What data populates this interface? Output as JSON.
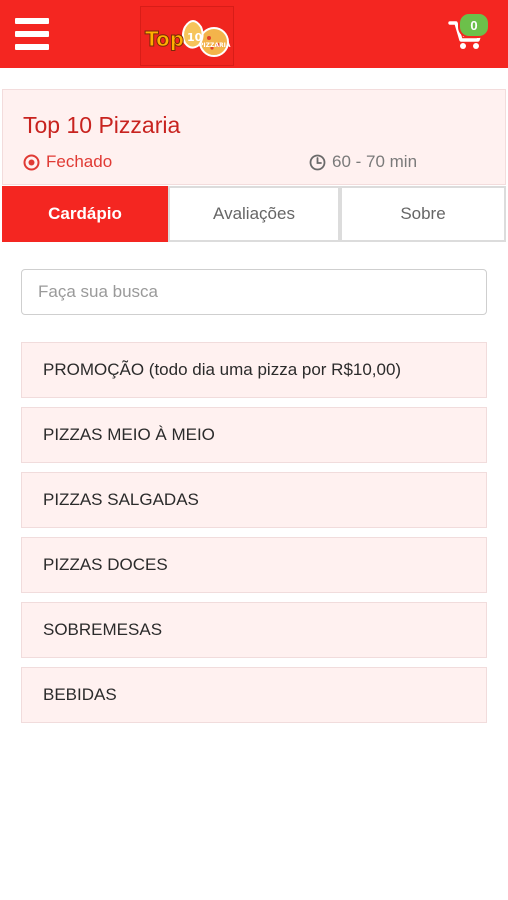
{
  "header": {
    "menu_icon": "hamburger-menu-icon",
    "logo": {
      "word": "Top",
      "digits": "10",
      "sub": "PIZZARIA"
    },
    "cart_icon": "shopping-cart-icon",
    "cart_count": "0",
    "colors": {
      "bar": "#f42621",
      "badge": "#6cc04a"
    }
  },
  "restaurant": {
    "name": "Top 10 Pizzaria",
    "status_icon": "closed-status-icon",
    "status": "Fechado",
    "time_icon": "clock-icon",
    "delivery_time": "60 - 70 min"
  },
  "tabs": [
    {
      "label": "Cardápio",
      "active": true
    },
    {
      "label": "Avaliações",
      "active": false
    },
    {
      "label": "Sobre",
      "active": false
    }
  ],
  "search": {
    "placeholder": "Faça sua busca",
    "value": ""
  },
  "categories": [
    "PROMOÇÃO (todo dia uma pizza por R$10,00)",
    "PIZZAS MEIO À MEIO",
    "PIZZAS SALGADAS",
    "PIZZAS DOCES",
    "SOBREMESAS",
    "BEBIDAS"
  ]
}
